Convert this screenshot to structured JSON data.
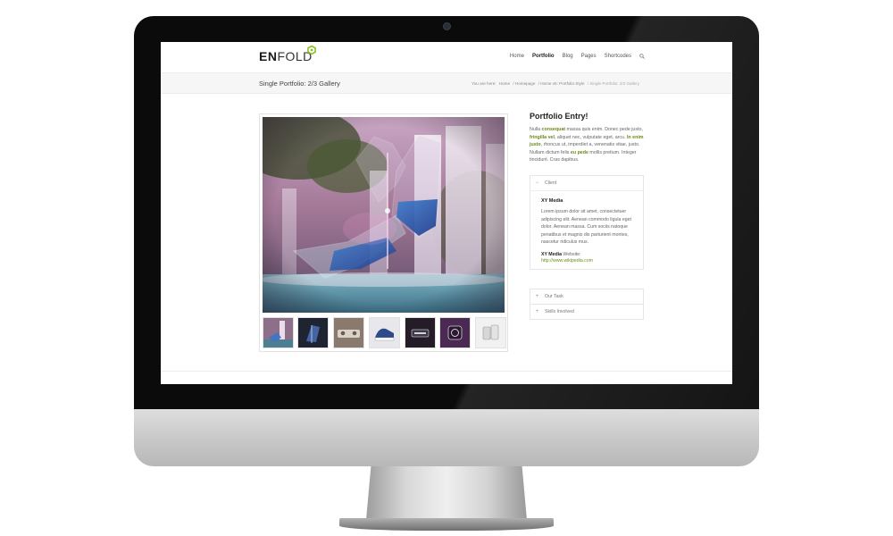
{
  "logo": {
    "en": "EN",
    "fold": "FOLD"
  },
  "nav": {
    "items": [
      "Home",
      "Portfolio",
      "Blog",
      "Pages",
      "Shortcodes"
    ],
    "active": "Portfolio"
  },
  "titlebar": {
    "title": "Single Portfolio: 2/3 Gallery",
    "breadcrumb": {
      "prefix": "You are here:",
      "items": [
        "Home",
        "/ Homepage",
        "/ Home v5: Portfolio Style",
        "/ Single Portfolio: 2/3 Gallery"
      ]
    }
  },
  "gallery": {
    "thumbnail_count": 7
  },
  "entry": {
    "title": "Portfolio Entry!",
    "text": {
      "p1": "Nulla ",
      "b1": "consequat",
      "p2": " massa quis enim. Donec pede justo, ",
      "b2": "fringilla vel",
      "p3": ", aliquet nec, vulputate eget, arcu. ",
      "b3": "In enim justo",
      "p4": ", rhoncus ut, imperdiet a, venenatis vitae, justo. Nullam dictum felis ",
      "b4": "eu pede",
      "p5": " mollis pretium. Integer tincidunt. Cras dapibus."
    }
  },
  "toggles": {
    "client": {
      "label": "Client",
      "body_title": "XY Media",
      "body_text": "Lorem ipsum dolor sit amet, consectetuer adipiscing elit. Aenean commodo ligula eget dolor. Aenean massa. Cum sociis natoque penatibus et magnis dis parturient montes, nascetur ridiculus mus.",
      "website_name": "XY Media",
      "website_label": " Website:",
      "website_url": "http://www.wikipedia.com"
    },
    "task": {
      "label": "Our Task"
    },
    "skills": {
      "label": "Skills Involved"
    }
  },
  "colors": {
    "accent": "#6b8a1a",
    "logo_mark": "#8cbf26"
  }
}
